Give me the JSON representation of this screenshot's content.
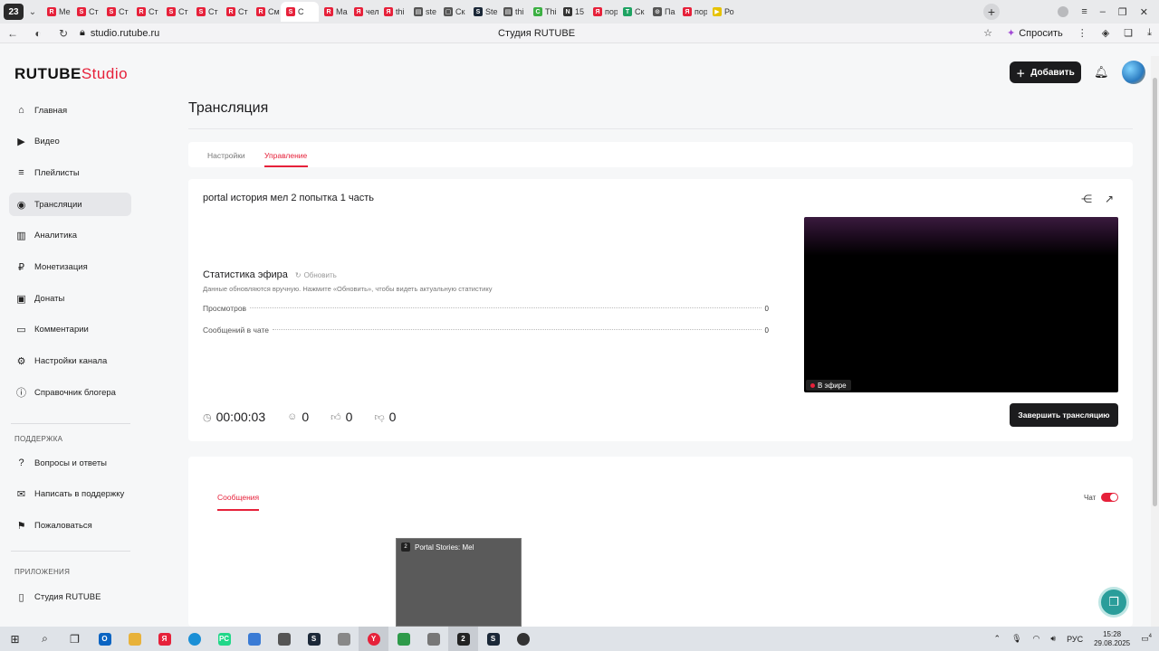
{
  "browser": {
    "tab_counter": "23",
    "tabs": [
      {
        "label": "Ме",
        "fav": "R",
        "color": "#e6213a"
      },
      {
        "label": "Ст",
        "fav": "S",
        "color": "#e6213a"
      },
      {
        "label": "Ст",
        "fav": "S",
        "color": "#e6213a"
      },
      {
        "label": "Ст",
        "fav": "R",
        "color": "#e6213a"
      },
      {
        "label": "Ст",
        "fav": "S",
        "color": "#e6213a"
      },
      {
        "label": "Ст",
        "fav": "S",
        "color": "#e6213a"
      },
      {
        "label": "Ст",
        "fav": "R",
        "color": "#e6213a"
      },
      {
        "label": "См",
        "fav": "R",
        "color": "#e6213a"
      },
      {
        "label": "С",
        "fav": "S",
        "color": "#e6213a",
        "active": true
      },
      {
        "label": "Ма",
        "fav": "R",
        "color": "#e6213a"
      },
      {
        "label": "чел",
        "fav": "Я",
        "color": "#e6213a"
      },
      {
        "label": "thi",
        "fav": "Я",
        "color": "#e6213a"
      },
      {
        "label": "ste",
        "fav": "▤",
        "color": "#555"
      },
      {
        "label": "Ск",
        "fav": "▢",
        "color": "#555"
      },
      {
        "label": "Ste",
        "fav": "S",
        "color": "#1b2838"
      },
      {
        "label": "thi",
        "fav": "▤",
        "color": "#555"
      },
      {
        "label": "Thi",
        "fav": "C",
        "color": "#3cb043"
      },
      {
        "label": "15",
        "fav": "N",
        "color": "#333"
      },
      {
        "label": "пор",
        "fav": "Я",
        "color": "#e6213a"
      },
      {
        "label": "Ск",
        "fav": "T",
        "color": "#1ea362"
      },
      {
        "label": "Па",
        "fav": "⊙",
        "color": "#555"
      },
      {
        "label": "пор",
        "fav": "Я",
        "color": "#e6213a"
      },
      {
        "label": "Ро",
        "fav": "▶",
        "color": "#e6c200"
      }
    ],
    "url": "studio.rutube.ru",
    "page_name": "Студия RUTUBE",
    "ask_label": "Спросить"
  },
  "logo": {
    "brand": "RUTUBE",
    "suffix": "Studio"
  },
  "sidebar": {
    "items": [
      {
        "label": "Главная",
        "icon": "home-icon",
        "glyph": "⌂"
      },
      {
        "label": "Видео",
        "icon": "video-icon",
        "glyph": "▶"
      },
      {
        "label": "Плейлисты",
        "icon": "playlist-icon",
        "glyph": "≡"
      },
      {
        "label": "Трансляции",
        "icon": "broadcast-icon",
        "glyph": "◉",
        "active": true
      },
      {
        "label": "Аналитика",
        "icon": "analytics-icon",
        "glyph": "▥"
      },
      {
        "label": "Монетизация",
        "icon": "monetization-icon",
        "glyph": "₽"
      },
      {
        "label": "Донаты",
        "icon": "donations-icon",
        "glyph": "▣"
      },
      {
        "label": "Комментарии",
        "icon": "comments-icon",
        "glyph": "▭"
      },
      {
        "label": "Настройки канала",
        "icon": "settings-icon",
        "glyph": "⚙"
      },
      {
        "label": "Справочник блогера",
        "icon": "info-icon",
        "glyph": "ⓘ"
      }
    ],
    "support_title": "ПОДДЕРЖКА",
    "support_items": [
      {
        "label": "Вопросы и ответы",
        "icon": "faq-icon",
        "glyph": "?"
      },
      {
        "label": "Написать в поддержку",
        "icon": "mail-icon",
        "glyph": "✉"
      },
      {
        "label": "Пожаловаться",
        "icon": "flag-icon",
        "glyph": "⚑"
      }
    ],
    "apps_title": "ПРИЛОЖЕНИЯ",
    "app_items": [
      {
        "label": "Студия RUTUBE",
        "icon": "phone-icon",
        "glyph": "▯"
      }
    ]
  },
  "header": {
    "add_label": "Добавить"
  },
  "page": {
    "title": "Трансляция",
    "tabs": [
      {
        "label": "Настройки"
      },
      {
        "label": "Управление",
        "active": true
      }
    ]
  },
  "broadcast": {
    "title": "portal история мел 2 попытка 1 часть",
    "stats_title": "Статистика эфира",
    "refresh_label": "Обновить",
    "stats_note": "Данные обновляются вручную. Нажмите «Обновить», чтобы видеть актуальную статистику",
    "stats": [
      {
        "label": "Просмотров",
        "value": "0"
      },
      {
        "label": "Сообщений в чате",
        "value": "0"
      }
    ],
    "live_label": "В эфире",
    "duration": "00:00:03",
    "viewers": "0",
    "likes": "0",
    "dislikes": "0",
    "end_label": "Завершить трансляцию"
  },
  "messages": {
    "tab_label": "Сообщения",
    "chat_label": "Чат",
    "chat_enabled": true
  },
  "taskbar_preview": {
    "title": "Portal Stories: Mel"
  },
  "tray": {
    "lang": "РУС",
    "time": "15:28",
    "date": "29.08.2025",
    "notifications": "4"
  }
}
